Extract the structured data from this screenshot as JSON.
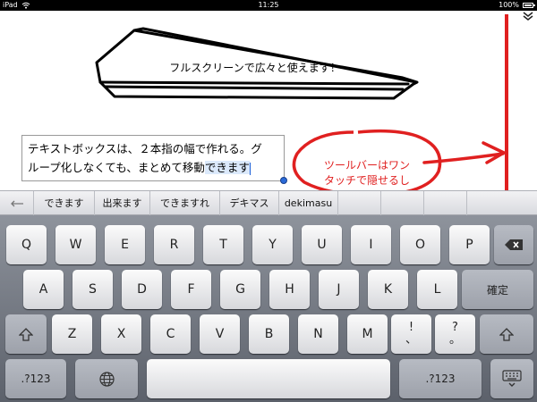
{
  "status_bar": {
    "carrier": "iPad",
    "time": "11:25",
    "battery": "100%",
    "battery_level": 1.0
  },
  "canvas": {
    "hero_text": "フルスクリーンで広々と使えます！",
    "textbox_lines": [
      "テキストボックスは、２本指の幅で作れる。グ",
      "ループ化しなくても、まとめて移動"
    ],
    "textbox_highlight": "できます",
    "annotation_lines": [
      "ツールバーはワン",
      "タッチで隠せるし"
    ],
    "colors": {
      "ink": "#000000",
      "marker": "#e02020",
      "selection": "#dbe9fb",
      "caret": "#1b5fd8"
    }
  },
  "candidate_bar": {
    "back_icon": "arrow-left-icon",
    "candidates": [
      "できます",
      "出来ます",
      "できますれ",
      "デキマス",
      "dekimasu"
    ]
  },
  "keyboard": {
    "row1": [
      "Q",
      "W",
      "E",
      "R",
      "T",
      "Y",
      "U",
      "I",
      "O",
      "P"
    ],
    "row2": [
      "A",
      "S",
      "D",
      "F",
      "G",
      "H",
      "J",
      "K",
      "L"
    ],
    "row3": [
      "Z",
      "X",
      "C",
      "V",
      "B",
      "N",
      "M"
    ],
    "punct1": [
      "!",
      "、"
    ],
    "punct2": [
      "?",
      "。"
    ],
    "enter_label": "確定",
    "numbers_label": ".?123",
    "icons": {
      "backspace": "backspace-icon",
      "shift": "shift-icon",
      "globe": "globe-icon",
      "hide": "keyboard-hide-icon"
    }
  }
}
